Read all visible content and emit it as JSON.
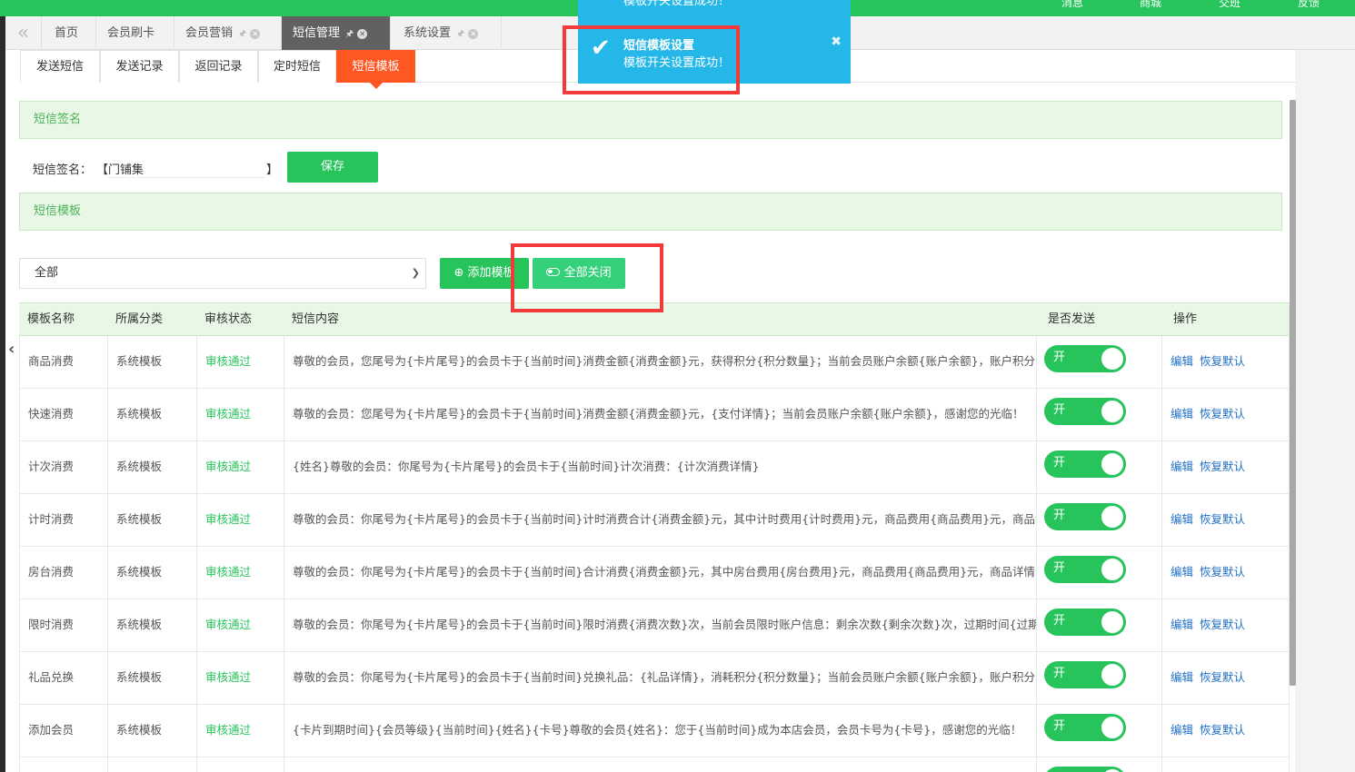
{
  "topnav": [
    "消息",
    "商城",
    "交班",
    "反馈"
  ],
  "tabs": {
    "collapse_icon": "«",
    "items": [
      {
        "label": "首页",
        "closable": false,
        "active": false
      },
      {
        "label": "会员刷卡",
        "closable": false,
        "active": false
      },
      {
        "label": "会员营销",
        "closable": true,
        "active": false
      },
      {
        "label": "短信管理",
        "closable": true,
        "active": true
      },
      {
        "label": "系统设置",
        "closable": true,
        "active": false
      }
    ]
  },
  "subtabs": [
    {
      "label": "发送短信",
      "active": false
    },
    {
      "label": "发送记录",
      "active": false
    },
    {
      "label": "返回记录",
      "active": false
    },
    {
      "label": "定时短信",
      "active": false
    },
    {
      "label": "短信模板",
      "active": true
    }
  ],
  "signature_panel": {
    "title": "短信签名",
    "label": "短信签名：",
    "bracket_open": "【",
    "value": "门铺集",
    "bracket_close": "】",
    "save_label": "保存"
  },
  "template_panel": {
    "title": "短信模板",
    "filter_selected": "全部",
    "add_label": "添加模板",
    "close_all_label": "全部关闭"
  },
  "table": {
    "headers": [
      "模板名称",
      "所属分类",
      "审核状态",
      "短信内容",
      "是否发送",
      "操作"
    ],
    "toggle_on_label": "开",
    "actions": [
      "编辑",
      "恢复默认"
    ],
    "rows": [
      {
        "name": "商品消费",
        "category": "系统模板",
        "status": "审核通过",
        "content": "尊敬的会员，您尾号为{卡片尾号}的会员卡于{当前时间}消费金额{消费金额}元，获得积分{积分数量}；当前会员账户余额{账户余额}，账户积分{账户积分}"
      },
      {
        "name": "快速消费",
        "category": "系统模板",
        "status": "审核通过",
        "content": "尊敬的会员：您尾号为{卡片尾号}的会员卡于{当前时间}消费金额{消费金额}元，{支付详情}；当前会员账户余额{账户余额}，感谢您的光临！"
      },
      {
        "name": "计次消费",
        "category": "系统模板",
        "status": "审核通过",
        "content": "{姓名}尊敬的会员：你尾号为{卡片尾号}的会员卡于{当前时间}计次消费：{计次消费详情}"
      },
      {
        "name": "计时消费",
        "category": "系统模板",
        "status": "审核通过",
        "content": "尊敬的会员：你尾号为{卡片尾号}的会员卡于{当前时间}计时消费合计{消费金额}元，其中计时费用{计时费用}元，商品费用{商品费用}元，商品详情"
      },
      {
        "name": "房台消费",
        "category": "系统模板",
        "status": "审核通过",
        "content": "尊敬的会员：你尾号为{卡片尾号}的会员卡于{当前时间}合计消费{消费金额}元，其中房台费用{房台费用}元，商品费用{商品费用}元，商品详情{商品详情}"
      },
      {
        "name": "限时消费",
        "category": "系统模板",
        "status": "审核通过",
        "content": "尊敬的会员：你尾号为{卡片尾号}的会员卡于{当前时间}限时消费{消费次数}次，当前会员限时账户信息：剩余次数{剩余次数}次，过期时间{过期时间}"
      },
      {
        "name": "礼品兑换",
        "category": "系统模板",
        "status": "审核通过",
        "content": "尊敬的会员：你尾号为{卡片尾号}的会员卡于{当前时间}兑换礼品：{礼品详情}，消耗积分{积分数量}；当前会员账户余额{账户余额}，账户积分{账户积分}"
      },
      {
        "name": "添加会员",
        "category": "系统模板",
        "status": "审核通过",
        "content": "{卡片到期时间}{会员等级}{当前时间}{姓名}{卡号}尊敬的会员{姓名}：您于{当前时间}成为本店会员，会员卡号为{卡号}，感谢您的光临！"
      },
      {
        "name": "",
        "category": "",
        "status": "",
        "content": ""
      }
    ]
  },
  "toasts": [
    {
      "title": "",
      "message": "模板开关设置成功！"
    },
    {
      "title": "短信模板设置",
      "message": "模板开关设置成功！"
    }
  ],
  "colors": {
    "brand_green": "#27c45c",
    "accent_orange": "#ff5722",
    "toast_blue": "#25b7e8",
    "highlight_red": "#f23a3a",
    "link_blue": "#1e6fc7"
  }
}
